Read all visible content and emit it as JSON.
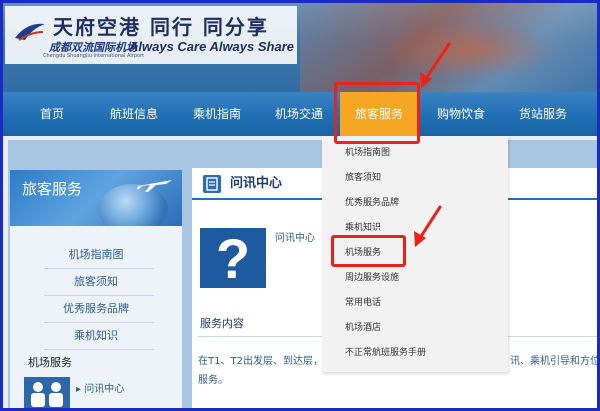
{
  "logo": {
    "slogan_cn": "天府空港  同行  同分享",
    "name_cn": "成都双流国际机场",
    "name_en": "Chengdu Shuangliu International Airport",
    "slogan_en": "Always Care Always Share"
  },
  "nav": {
    "items": [
      {
        "label": "首页"
      },
      {
        "label": "航班信息"
      },
      {
        "label": "乘机指南"
      },
      {
        "label": "机场交通"
      },
      {
        "label": "旅客服务"
      },
      {
        "label": "购物饮食"
      },
      {
        "label": "货站服务"
      }
    ],
    "active_index": 4,
    "active_color": "#f5a623"
  },
  "dropdown": {
    "items": [
      {
        "label": "机场指南图"
      },
      {
        "label": "旅客须知"
      },
      {
        "label": "优秀服务品牌"
      },
      {
        "label": "乘机知识"
      },
      {
        "label": "机场服务"
      },
      {
        "label": "周边服务设施"
      },
      {
        "label": "常用电话"
      },
      {
        "label": "机场酒店"
      },
      {
        "label": "不正常航班服务手册"
      }
    ]
  },
  "sidebar": {
    "title": "旅客服务",
    "links": [
      {
        "label": "机场指南图"
      },
      {
        "label": "旅客须知"
      },
      {
        "label": "优秀服务品牌"
      },
      {
        "label": "乘机知识"
      }
    ],
    "section": "机场服务",
    "sub": "问讯中心"
  },
  "main": {
    "header_title": "问讯中心",
    "small_title": "问讯中心",
    "service_title": "服务内容",
    "service_text_1": "在T1、T2出发层、到达层，T2",
    "service_text_right": "讯、乘机引导和方位指",
    "service_text_2": "服务。"
  },
  "colors": {
    "annotation": "#e8231a",
    "nav_bg": "#1e6db3",
    "frame": "#1a2bc4"
  }
}
